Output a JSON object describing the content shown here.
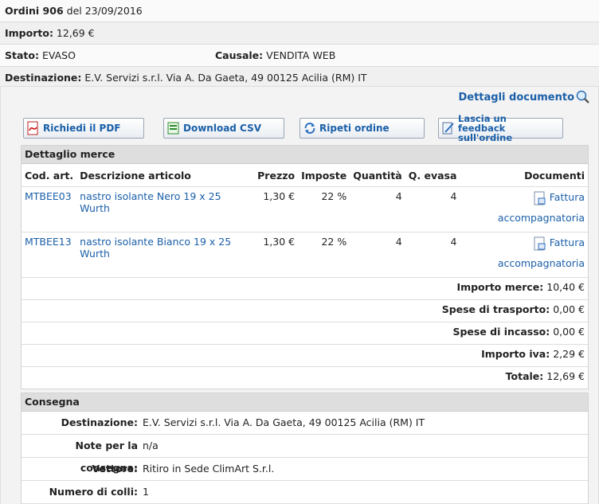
{
  "order": {
    "title_label": "Ordini 906",
    "title_date": "del 23/09/2016",
    "importo_label": "Importo:",
    "importo_value": "12,69 €",
    "stato_label": "Stato:",
    "stato_value": "EVASO",
    "causale_label": "Causale:",
    "causale_value": "VENDITA WEB",
    "destinazione_label": "Destinazione:",
    "destinazione_value": "E.V. Servizi s.r.l. Via A. Da Gaeta, 49 00125 Acilia (RM) IT"
  },
  "dettagli_link": "Dettagli documento",
  "buttons": {
    "pdf": "Richiedi il PDF",
    "csv": "Download CSV",
    "repeat": "Ripeti ordine",
    "feedback": "Lascia un feedback sull'ordine"
  },
  "merce": {
    "heading": "Dettaglio merce",
    "columns": [
      "Cod. art.",
      "Descrizione articolo",
      "Prezzo",
      "Imposte",
      "Quantità",
      "Q. evasa",
      "Documenti"
    ],
    "rows": [
      {
        "code": "MTBEE03",
        "desc": "nastro isolante Nero 19 x 25 Wurth",
        "price": "1,30 €",
        "tax": "22 %",
        "qty": "4",
        "qty_done": "4",
        "doc": "Fattura accompagnatoria"
      },
      {
        "code": "MTBEE13",
        "desc": "nastro isolante Bianco 19 x 25 Wurth",
        "price": "1,30 €",
        "tax": "22 %",
        "qty": "4",
        "qty_done": "4",
        "doc": "Fattura accompagnatoria"
      }
    ],
    "summary": [
      {
        "label": "Importo merce:",
        "value": "10,40 €"
      },
      {
        "label": "Spese di trasporto:",
        "value": "0,00 €"
      },
      {
        "label": "Spese di incasso:",
        "value": "0,00 €"
      },
      {
        "label": "Importo iva:",
        "value": "2,29 €"
      },
      {
        "label": "Totale:",
        "value": "12,69 €"
      }
    ]
  },
  "consegna": {
    "heading": "Consegna",
    "rows": [
      {
        "label": "Destinazione:",
        "value": "E.V. Servizi s.r.l. Via A. Da Gaeta, 49 00125 Acilia (RM) IT"
      },
      {
        "label": "Note per la consegna:",
        "value": "n/a"
      },
      {
        "label": "Vettore:",
        "value": "Ritiro in Sede ClimArt S.r.l."
      },
      {
        "label": "Numero di colli:",
        "value": "1"
      }
    ]
  }
}
